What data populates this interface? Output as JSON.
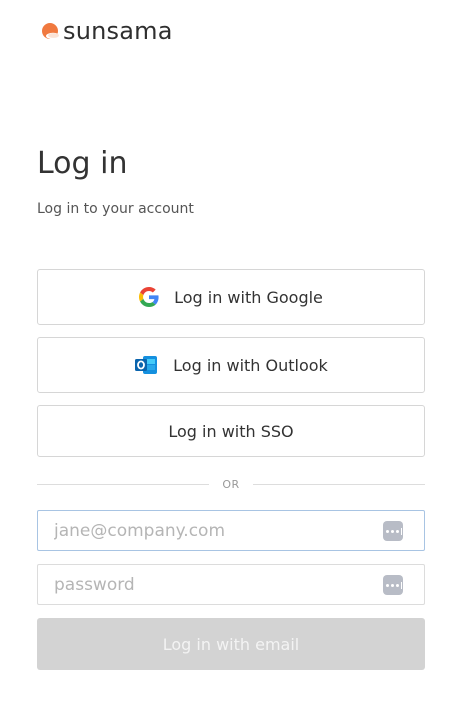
{
  "brand": {
    "name": "sunsama",
    "logo_icon": "sunsama-sun-cloud-icon",
    "accent_color": "#f0793f"
  },
  "login": {
    "title": "Log in",
    "subtitle": "Log in to your account"
  },
  "auth_buttons": {
    "google": {
      "label": "Log in with Google",
      "icon": "google-icon"
    },
    "outlook": {
      "label": "Log in with Outlook",
      "icon": "outlook-icon"
    },
    "sso": {
      "label": "Log in with SSO"
    }
  },
  "divider": {
    "label": "OR"
  },
  "form": {
    "email": {
      "placeholder": "jane@company.com",
      "value": "",
      "icon": "autofill-icon"
    },
    "password": {
      "placeholder": "password",
      "value": "",
      "icon": "autofill-icon"
    },
    "submit": {
      "label": "Log in with email",
      "disabled_color": "#d3d3d3"
    }
  }
}
